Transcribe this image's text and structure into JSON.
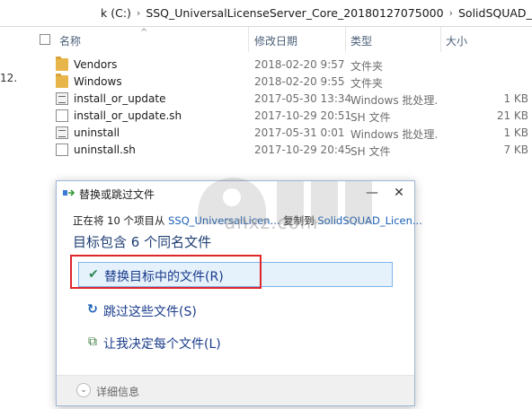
{
  "address": {
    "crumbs": [
      "k (C:)",
      "SSQ_UniversalLicenseServer_Core_20180127075000",
      "SolidSQUAD_License_Servers"
    ],
    "separator": "›"
  },
  "sidebar": {
    "partial_label": "12."
  },
  "columns": {
    "name": "名称",
    "date": "修改日期",
    "type": "类型",
    "size": "大小"
  },
  "files": [
    {
      "name": "Vendors",
      "date": "2018-02-20 9:57",
      "type": "文件夹",
      "size": "",
      "icon": "folder-icon"
    },
    {
      "name": "Windows",
      "date": "2018-02-20 9:55",
      "type": "文件夹",
      "size": "",
      "icon": "folder-icon"
    },
    {
      "name": "install_or_update",
      "date": "2017-05-30 13:34",
      "type": "Windows 批处理...",
      "size": "1 KB",
      "icon": "batch-file-icon"
    },
    {
      "name": "install_or_update.sh",
      "date": "2017-10-29 20:51",
      "type": "SH 文件",
      "size": "21 KB",
      "icon": "file-icon"
    },
    {
      "name": "uninstall",
      "date": "2017-05-31 0:01",
      "type": "Windows 批处理...",
      "size": "1 KB",
      "icon": "batch-file-icon"
    },
    {
      "name": "uninstall.sh",
      "date": "2017-10-29 20:45",
      "type": "SH 文件",
      "size": "7 KB",
      "icon": "file-icon"
    }
  ],
  "dialog": {
    "title": "替换或跳过文件",
    "minimize": "—",
    "close": "✕",
    "info_prefix": "正在将 10 个项目从",
    "source": "SSQ_UniversalLicen...",
    "info_mid": "复制到",
    "target": "SolidSQUAD_Licen...",
    "heading": "目标包含 6 个同名文件",
    "options": [
      {
        "label": "替换目标中的文件(R)",
        "icon": "check-icon",
        "glyph": "✔"
      },
      {
        "label": "跳过这些文件(S)",
        "icon": "skip-icon",
        "glyph": "↻"
      },
      {
        "label": "让我决定每个文件(L)",
        "icon": "decide-icon",
        "glyph": "⧉"
      }
    ],
    "details": "详细信息",
    "details_glyph": "⌄"
  },
  "watermark": {
    "text": "anxz.com"
  },
  "colors": {
    "highlight": "#e0262b",
    "selected_bg": "#e5f1fb",
    "link": "#1a5fb4",
    "heading": "#1f3f74"
  }
}
